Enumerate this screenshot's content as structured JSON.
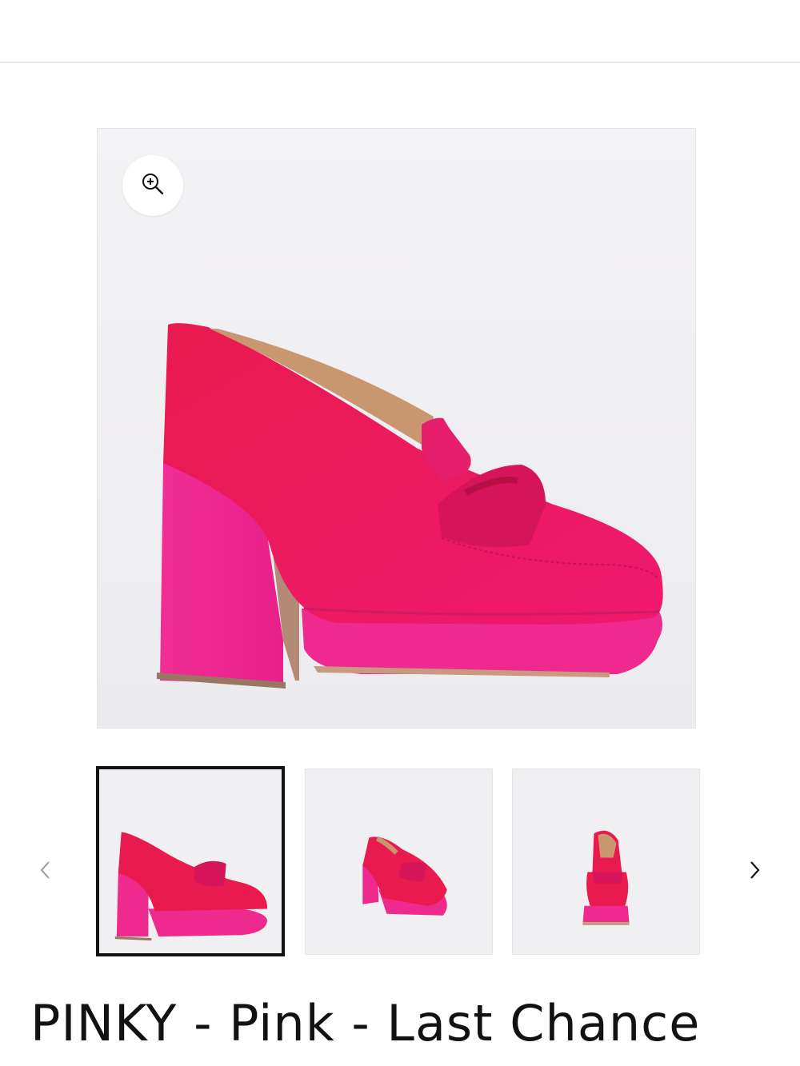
{
  "header": {},
  "gallery": {
    "zoom_icon": "zoom-in-icon",
    "main_image_alt": "Pink velvet platform loafer heel, side view",
    "thumbnails": [
      {
        "alt": "Side view",
        "selected": true
      },
      {
        "alt": "Three-quarter view",
        "selected": false
      },
      {
        "alt": "Front view",
        "selected": false
      }
    ],
    "prev_icon": "chevron-left-icon",
    "next_icon": "chevron-right-icon"
  },
  "product": {
    "title": "PINKY - Pink - Last Chance"
  },
  "colors": {
    "accent_pink": "#e8186a",
    "selected_border": "#121212",
    "text": "#121212"
  }
}
